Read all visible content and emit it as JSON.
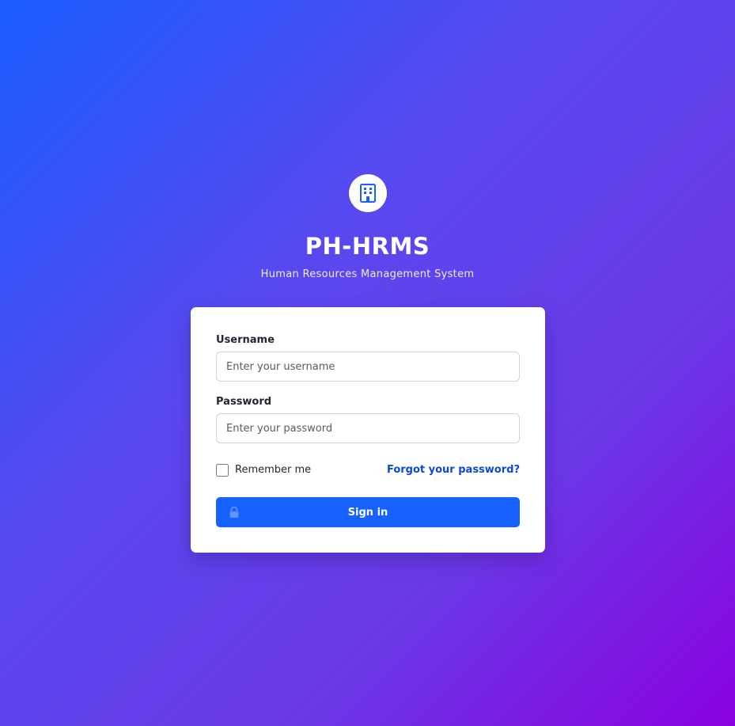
{
  "app": {
    "title": "PH-HRMS",
    "subtitle": "Human Resources Management System",
    "logo_icon": "building-icon"
  },
  "form": {
    "username_label": "Username",
    "username_placeholder": "Enter your username",
    "username_value": "",
    "password_label": "Password",
    "password_placeholder": "Enter your password",
    "password_value": "",
    "remember_label": "Remember me",
    "remember_checked": false,
    "forgot_label": "Forgot your password?",
    "signin_label": "Sign in",
    "signin_icon": "lock-icon"
  },
  "colors": {
    "gradient_start": "#1a5cff",
    "gradient_end": "#8a00e0",
    "primary_button": "#1762ff",
    "link": "#0d47d9"
  }
}
